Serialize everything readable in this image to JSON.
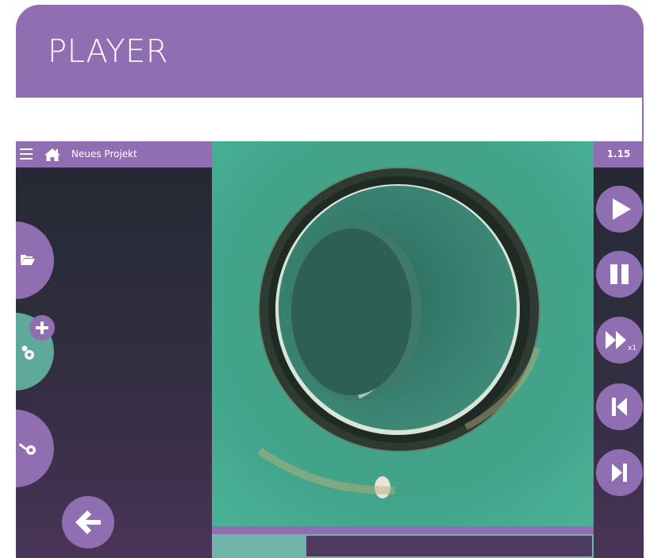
{
  "header": {
    "title": "PLAYER"
  },
  "app": {
    "project_title": "Neues Projekt",
    "version": "1.15"
  },
  "left_buttons": [
    {
      "icon": "folder-open-icon"
    },
    {
      "icon": "pipe-camera-add-icon",
      "badge_icon": "plus-icon"
    },
    {
      "icon": "pipe-camera-icon"
    }
  ],
  "back_icon": "arrow-left-icon",
  "controls": [
    {
      "icon": "play-icon"
    },
    {
      "icon": "pause-icon"
    },
    {
      "icon": "fast-forward-icon",
      "speed_label": "x1"
    },
    {
      "icon": "skip-back-icon"
    },
    {
      "icon": "skip-forward-icon"
    }
  ],
  "playback": {
    "progress": 0.245
  },
  "colors": {
    "accent": "#8f6fb2",
    "teal": "#6fb5aa",
    "video_green": "#3fa88f"
  }
}
